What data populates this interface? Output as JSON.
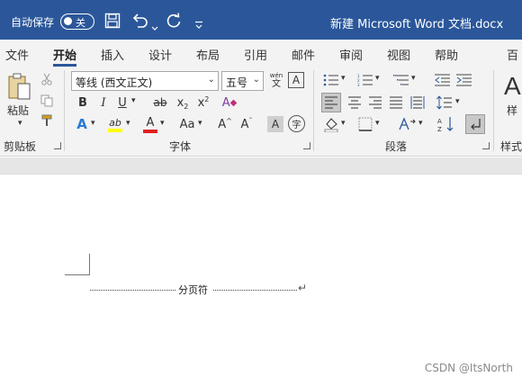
{
  "titlebar": {
    "autosave_label": "自动保存",
    "toggle_state": "关",
    "doc_title": "新建 Microsoft Word 文档.docx"
  },
  "tabs": [
    {
      "label": "文件"
    },
    {
      "label": "开始"
    },
    {
      "label": "插入"
    },
    {
      "label": "设计"
    },
    {
      "label": "布局"
    },
    {
      "label": "引用"
    },
    {
      "label": "邮件"
    },
    {
      "label": "审阅"
    },
    {
      "label": "视图"
    },
    {
      "label": "帮助"
    },
    {
      "label": "百"
    }
  ],
  "clipboard": {
    "paste_label": "粘贴",
    "group_label": "剪贴板"
  },
  "font": {
    "font_name": "等线 (西文正文)",
    "font_size": "五号",
    "group_label": "字体",
    "bold": "B",
    "italic": "I",
    "underline": "U",
    "strike": "ab",
    "subscript": "x",
    "superscript": "x",
    "clear_format": "A",
    "text_effect": "A",
    "highlight": "ab",
    "font_color": "A",
    "change_case": "Aa",
    "grow": "A",
    "shrink": "A",
    "char_shade": "A",
    "enclose": "字",
    "phonetic_top": "wén",
    "phonetic_bottom": "文",
    "char_border": "A"
  },
  "paragraph": {
    "group_label": "段落"
  },
  "styles": {
    "group_label": "样式",
    "sample_letter": "A",
    "sample_label": "样"
  },
  "document": {
    "page_break_text": "分页符"
  },
  "watermark": "CSDN @ItsNorth",
  "colors": {
    "brand": "#2b579a",
    "highlight_yellow": "#ffff00",
    "font_red": "#e02020"
  }
}
